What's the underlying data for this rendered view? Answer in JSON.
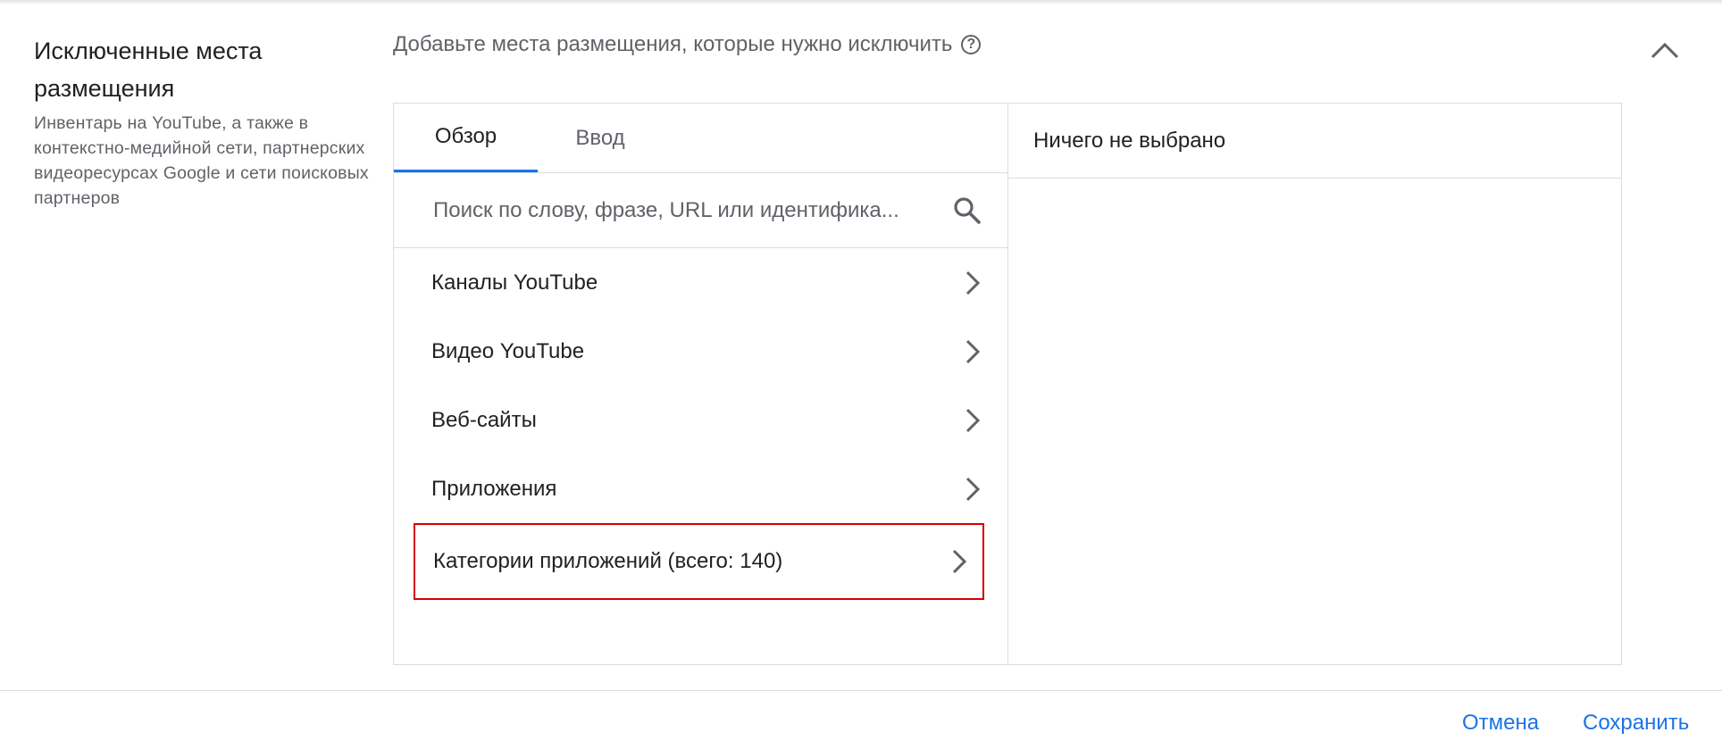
{
  "section": {
    "title": "Исключенные места размещения",
    "description": "Инвентарь на YouTube, а также в контекстно-медийной сети, партнерских видеоресурсах Google и сети поисковых партнеров"
  },
  "hint": {
    "text": "Добавьте места размещения, которые нужно исключить",
    "help_icon": "help-circle-icon"
  },
  "tabs": [
    {
      "label": "Обзор",
      "active": true
    },
    {
      "label": "Ввод",
      "active": false
    }
  ],
  "search": {
    "placeholder": "Поиск по слову, фразе, URL или идентифика...",
    "value": ""
  },
  "list": [
    {
      "label": "Каналы YouTube"
    },
    {
      "label": "Видео YouTube"
    },
    {
      "label": "Веб-сайты"
    },
    {
      "label": "Приложения"
    },
    {
      "label": "Категории приложений (всего: 140)",
      "highlighted": true
    }
  ],
  "selection": {
    "empty_text": "Ничего не выбрано"
  },
  "footer": {
    "cancel_label": "Отмена",
    "save_label": "Сохранить"
  },
  "colors": {
    "accent": "#1a73e8",
    "highlight_border": "#d50000",
    "text": "#202124",
    "secondary_text": "#5f6368"
  }
}
